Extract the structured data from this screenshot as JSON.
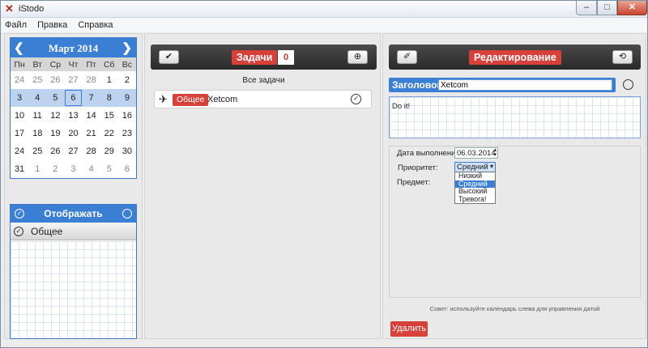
{
  "window": {
    "title": "iStodo",
    "app_icon": "x-logo-icon"
  },
  "menu": [
    "Файл",
    "Правка",
    "Справка"
  ],
  "calendar": {
    "month_title": "Март 2014",
    "weekdays": [
      "Пн",
      "Вт",
      "Ср",
      "Чт",
      "Пт",
      "Сб",
      "Вс"
    ],
    "weeks": [
      [
        "24",
        "25",
        "26",
        "27",
        "28",
        "1",
        "2"
      ],
      [
        "3",
        "4",
        "5",
        "6",
        "7",
        "8",
        "9"
      ],
      [
        "10",
        "11",
        "12",
        "13",
        "14",
        "15",
        "16"
      ],
      [
        "17",
        "18",
        "19",
        "20",
        "21",
        "22",
        "23"
      ],
      [
        "24",
        "25",
        "26",
        "27",
        "28",
        "29",
        "30"
      ],
      [
        "31",
        "1",
        "2",
        "3",
        "4",
        "5",
        "6"
      ]
    ],
    "selected_week": 1,
    "today": "6"
  },
  "show_panel": {
    "title": "Отображать",
    "items": [
      "Общее"
    ]
  },
  "tasks": {
    "title": "Задачи",
    "count": "0",
    "filter_label": "Все задачи",
    "items": [
      {
        "category": "Общее",
        "name": "Xetcom"
      }
    ]
  },
  "editor": {
    "title": "Редактирование",
    "heading_label": "Заголовок",
    "heading_value": "Xetcom",
    "description": "Do it!",
    "due_label": "Дата выполнения:",
    "due_value": "06.03.2014",
    "priority_label": "Приоритет:",
    "priority_value": "Средний",
    "priority_options": [
      "Низкий",
      "Средний",
      "Высокий",
      "Тревога!"
    ],
    "subject_label": "Предмет:",
    "hint": "Совет: используйте календарь слева для управления датой",
    "delete_label": "Удалить"
  },
  "colors": {
    "accent_blue": "#3b7fd4",
    "accent_red": "#d8413a",
    "dark_header": "#2f2f2f"
  }
}
